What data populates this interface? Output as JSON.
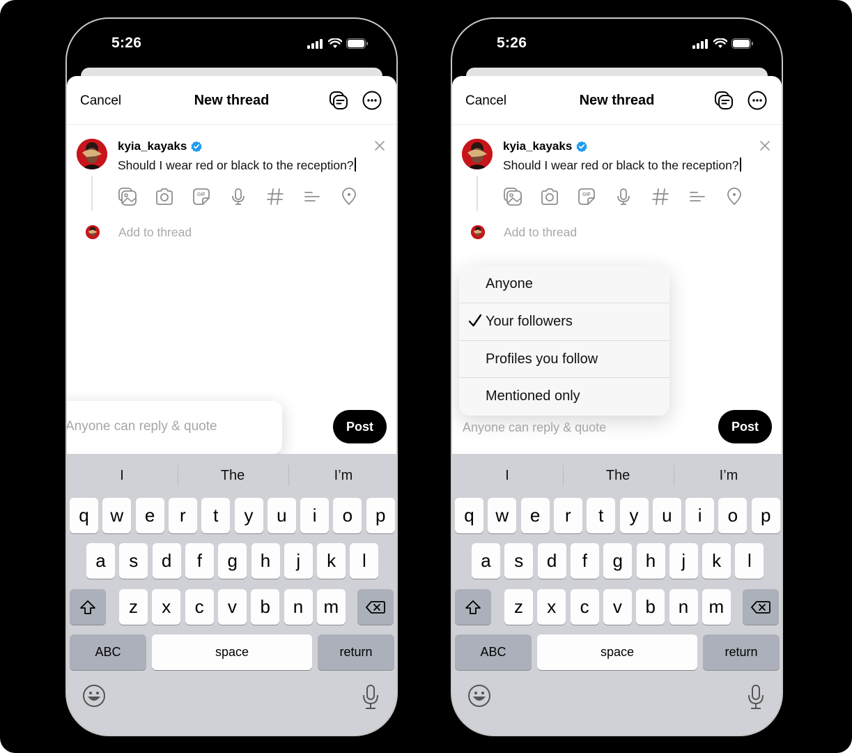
{
  "screens": [
    {
      "id": "left",
      "status_bar": {
        "time": "5:26"
      },
      "header": {
        "cancel_label": "Cancel",
        "title": "New thread",
        "drafts_icon": "drafts-stack-icon",
        "more_icon": "more-options-icon"
      },
      "post": {
        "username": "kyia_kayaks",
        "verified": true,
        "text": "Should I wear red or black to the reception?",
        "toolbar_icons": [
          "gallery-icon",
          "camera-icon",
          "gif-icon",
          "microphone-icon",
          "hashtag-icon",
          "poll-icon",
          "location-pin-icon"
        ],
        "add_to_thread_placeholder": "Add to thread"
      },
      "reply_setting": {
        "label": "Anyone can reply & quote",
        "highlighted": true
      },
      "post_button_label": "Post",
      "menu_open": false
    },
    {
      "id": "right",
      "status_bar": {
        "time": "5:26"
      },
      "header": {
        "cancel_label": "Cancel",
        "title": "New thread",
        "drafts_icon": "drafts-stack-icon",
        "more_icon": "more-options-icon"
      },
      "post": {
        "username": "kyia_kayaks",
        "verified": true,
        "text": "Should I wear red or black to the reception?",
        "toolbar_icons": [
          "gallery-icon",
          "camera-icon",
          "gif-icon",
          "microphone-icon",
          "hashtag-icon",
          "poll-icon",
          "location-pin-icon"
        ],
        "add_to_thread_placeholder": "Add to thread"
      },
      "reply_setting": {
        "label": "Anyone can reply & quote",
        "highlighted": false
      },
      "post_button_label": "Post",
      "menu_open": true,
      "reply_menu": {
        "options": [
          {
            "label": "Anyone",
            "checked": false
          },
          {
            "label": "Your followers",
            "checked": true
          },
          {
            "label": "Profiles you follow",
            "checked": false
          },
          {
            "label": "Mentioned only",
            "checked": false
          }
        ]
      }
    }
  ],
  "keyboard": {
    "suggestions": [
      "I",
      "The",
      "I’m"
    ],
    "rows": [
      [
        "q",
        "w",
        "e",
        "r",
        "t",
        "y",
        "u",
        "i",
        "o",
        "p"
      ],
      [
        "a",
        "s",
        "d",
        "f",
        "g",
        "h",
        "j",
        "k",
        "l"
      ],
      [
        "z",
        "x",
        "c",
        "v",
        "b",
        "n",
        "m"
      ]
    ],
    "shift_icon": "shift-icon",
    "delete_icon": "backspace-icon",
    "abc_label": "ABC",
    "space_label": "space",
    "return_label": "return",
    "emoji_icon": "emoji-icon",
    "dictation_icon": "microphone-icon"
  }
}
